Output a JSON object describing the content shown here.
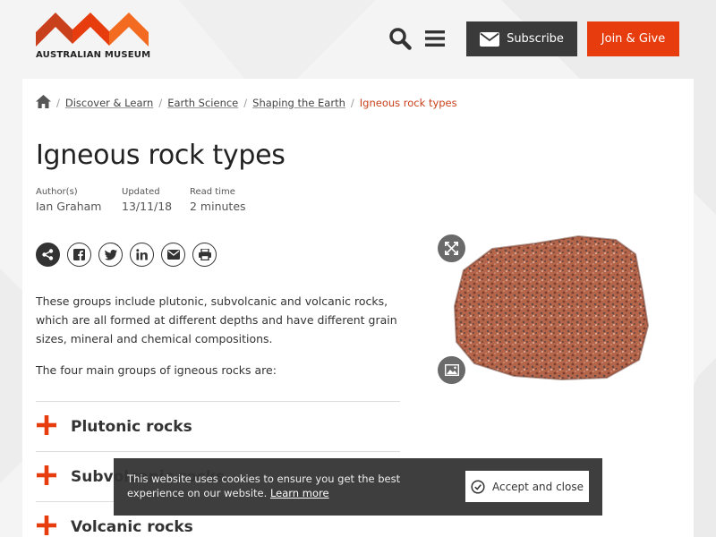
{
  "brand": {
    "name": "AUSTRALIAN MUSEUM",
    "accent": "#e63c0e",
    "dark": "#3a3a3a"
  },
  "header": {
    "subscribe_label": "Subscribe",
    "join_label": "Join & Give",
    "search_icon": "search-icon",
    "menu_icon": "hamburger-menu-icon"
  },
  "breadcrumb": {
    "home_icon": "home-icon",
    "items": [
      "Discover & Learn",
      "Earth Science",
      "Shaping the Earth"
    ],
    "current": "Igneous rock types"
  },
  "article": {
    "title": "Igneous rock types",
    "meta": [
      {
        "label": "Author(s)",
        "value": "Ian Graham"
      },
      {
        "label": "Updated",
        "value": "13/11/18"
      },
      {
        "label": "Read time",
        "value": "2 minutes"
      }
    ],
    "share_icons": [
      "share-icon",
      "facebook-icon",
      "twitter-icon",
      "linkedin-icon",
      "email-icon",
      "print-icon"
    ],
    "paragraphs": [
      "These groups include plutonic, subvolcanic and volcanic rocks, which are all formed at different depths and have different grain sizes, mineral and chemical compositions.",
      "The four main groups of igneous rocks are:"
    ],
    "accordion": [
      "Plutonic rocks",
      "Subvolcanic rocks",
      "Volcanic rocks"
    ]
  },
  "figure": {
    "expand_icon": "expand-icon",
    "gallery_icon": "image-icon"
  },
  "cookie": {
    "text": "This website uses cookies to ensure you get the best experience on our website.",
    "link": "Learn more",
    "accept_label": "Accept and close"
  }
}
